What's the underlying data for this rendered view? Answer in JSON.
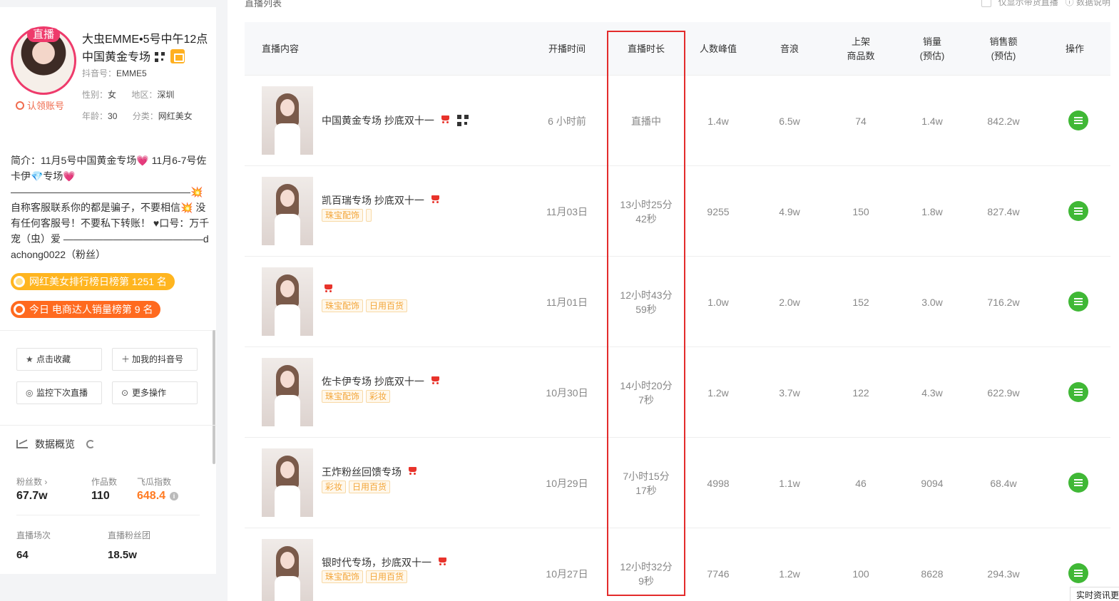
{
  "profile": {
    "live_tag": "直播",
    "claim": "认领账号",
    "name": "大虫EMME•5号中午12点中国黄金专场",
    "douyin_id_label": "抖音号：",
    "douyin_id": "EMME5",
    "gender_label": "性别：",
    "gender": "女",
    "region_label": "地区：",
    "region": "深圳",
    "age_label": "年龄：",
    "age": "30",
    "category_label": "分类：",
    "category": "网红美女",
    "bio": "简介：11月5号中国黄金专场💗 11月6-7号佐卡伊💎专场💗 ——————————————————💥自称客服联系你的都是骗子，不要相信💥 没有任何客服号！不要私下转账！ ♥口号：万千宠（虫）爱 ——————————————dachong0022（粉丝）",
    "rank1": "网红美女排行榜日榜第 1251 名",
    "rank2": "今日 电商达人销量榜第 9 名"
  },
  "actions": {
    "favorite": "点击收藏",
    "add_douyin": "加我的抖音号",
    "monitor": "监控下次直播",
    "more": "更多操作"
  },
  "overview": {
    "title": "数据概览",
    "fans_label": "粉丝数 ›",
    "fans": "67.7w",
    "works_label": "作品数",
    "works": "110",
    "feigua_label": "飞瓜指数",
    "feigua": "648.4",
    "live_count_label": "直播场次",
    "live_count": "64",
    "live_fans_label": "直播粉丝团",
    "live_fans": "18.5w"
  },
  "list": {
    "title": "直播列表",
    "only_goods": "仅显示带货直播",
    "data_desc": "数据说明"
  },
  "table": {
    "headers": {
      "content": "直播内容",
      "start": "开播时间",
      "duration": "直播时长",
      "peak": "人数峰值",
      "sound": "音浪",
      "goods_l1": "上架",
      "goods_l2": "商品数",
      "sales_l1": "销量",
      "sales_l2": "(预估)",
      "amount_l1": "销售额",
      "amount_l2": "(预估)",
      "op": "操作"
    },
    "rows": [
      {
        "title": "中国黄金专场 抄底双十一",
        "start": "6 小时前",
        "dur1": "直播中",
        "dur2": "",
        "peak": "1.4w",
        "sound": "6.5w",
        "goods": "74",
        "sales": "1.4w",
        "amount": "842.2w"
      },
      {
        "title": "凯百瑞专场 抄底双十一",
        "tag1": "珠宝配饰",
        "start": "11月03日",
        "dur1": "13小时25分",
        "dur2": "42秒",
        "peak": "9255",
        "sound": "4.9w",
        "goods": "150",
        "sales": "1.8w",
        "amount": "827.4w"
      },
      {
        "title": "",
        "tag1": "珠宝配饰",
        "tag2": "日用百货",
        "start": "11月01日",
        "dur1": "12小时43分",
        "dur2": "59秒",
        "peak": "1.0w",
        "sound": "2.0w",
        "goods": "152",
        "sales": "3.0w",
        "amount": "716.2w"
      },
      {
        "title": "佐卡伊专场 抄底双十一",
        "tag1": "珠宝配饰",
        "tag2": "彩妆",
        "start": "10月30日",
        "dur1": "14小时20分",
        "dur2": "7秒",
        "peak": "1.2w",
        "sound": "3.7w",
        "goods": "122",
        "sales": "4.3w",
        "amount": "622.9w"
      },
      {
        "title": "王炸粉丝回馈专场",
        "tag1": "彩妆",
        "tag2": "日用百货",
        "start": "10月29日",
        "dur1": "7小时15分",
        "dur2": "17秒",
        "peak": "4998",
        "sound": "1.1w",
        "goods": "46",
        "sales": "9094",
        "amount": "68.4w"
      },
      {
        "title": "银时代专场，抄底双十一",
        "tag1": "珠宝配饰",
        "tag2": "日用百货",
        "start": "10月27日",
        "dur1": "12小时32分",
        "dur2": "9秒",
        "peak": "7746",
        "sound": "1.2w",
        "goods": "100",
        "sales": "8628",
        "amount": "294.3w"
      }
    ]
  },
  "footer": {
    "chip": "实时资讯更"
  },
  "colors": {
    "highlight": "#e32b2b",
    "live_pink": "#ee3a6b",
    "op_green": "#40b836",
    "orange": "#ff7a21"
  }
}
